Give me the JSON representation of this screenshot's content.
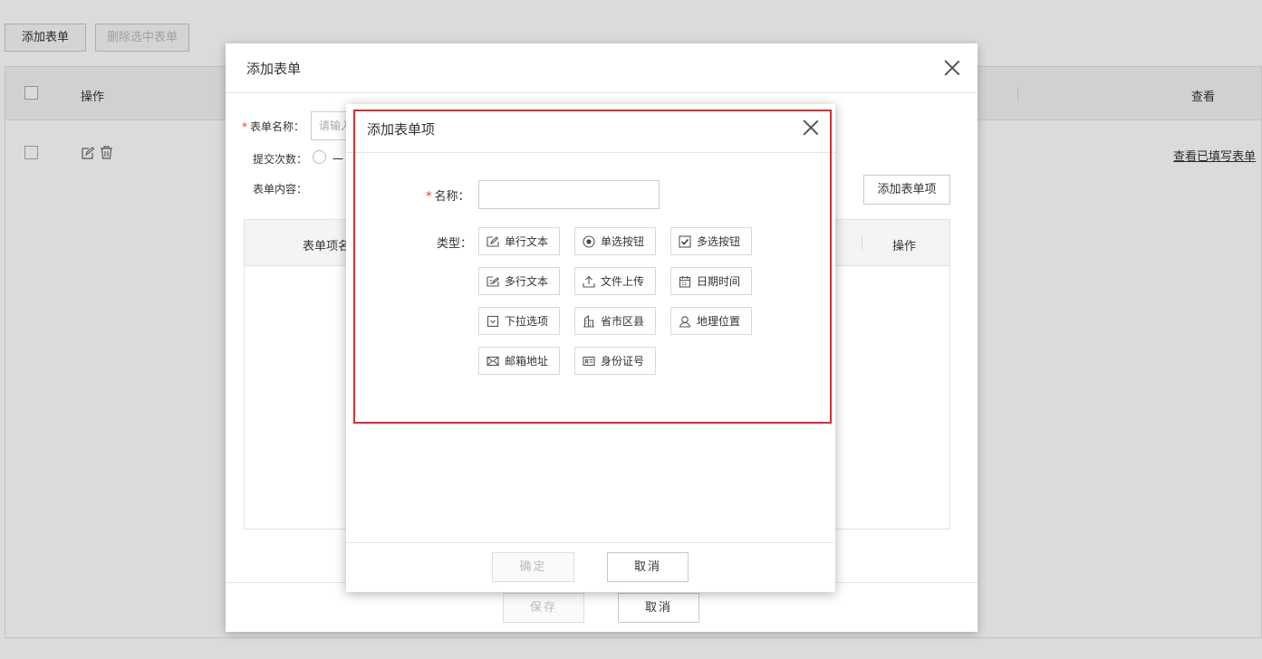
{
  "page": {
    "add_form_button": "添加表单",
    "delete_selected_button": "删除选中表单",
    "table": {
      "col_action": "操作",
      "col_view": "查看",
      "row_link": "查看已填写表单"
    }
  },
  "form_dialog": {
    "title": "添加表单",
    "name_label": "表单名称：",
    "name_placeholder": "请输入",
    "submit_count_label": "提交次数：",
    "submit_count_option": "一",
    "content_label": "表单内容：",
    "add_item_button": "添加表单项",
    "table": {
      "col_item_name": "表单项名",
      "col_action": "操作"
    },
    "save_button": "保存",
    "cancel_button": "取消"
  },
  "item_dialog": {
    "title": "添加表单项",
    "name_label": "名称：",
    "name_value": "",
    "type_label": "类型：",
    "types": [
      {
        "label": "单行文本",
        "icon": "edit-line-icon"
      },
      {
        "label": "单选按钮",
        "icon": "radio-icon"
      },
      {
        "label": "多选按钮",
        "icon": "checkbox-icon"
      },
      {
        "label": "多行文本",
        "icon": "edit-multiline-icon"
      },
      {
        "label": "文件上传",
        "icon": "upload-icon"
      },
      {
        "label": "日期时间",
        "icon": "calendar-icon"
      },
      {
        "label": "下拉选项",
        "icon": "dropdown-icon"
      },
      {
        "label": "省市区县",
        "icon": "building-icon"
      },
      {
        "label": "地理位置",
        "icon": "location-person-icon"
      },
      {
        "label": "邮箱地址",
        "icon": "mail-icon"
      },
      {
        "label": "身份证号",
        "icon": "id-card-icon"
      }
    ],
    "confirm_button": "确定",
    "cancel_button": "取消"
  },
  "colors": {
    "required_star": "#e33333",
    "highlight_frame": "#e5282e"
  }
}
